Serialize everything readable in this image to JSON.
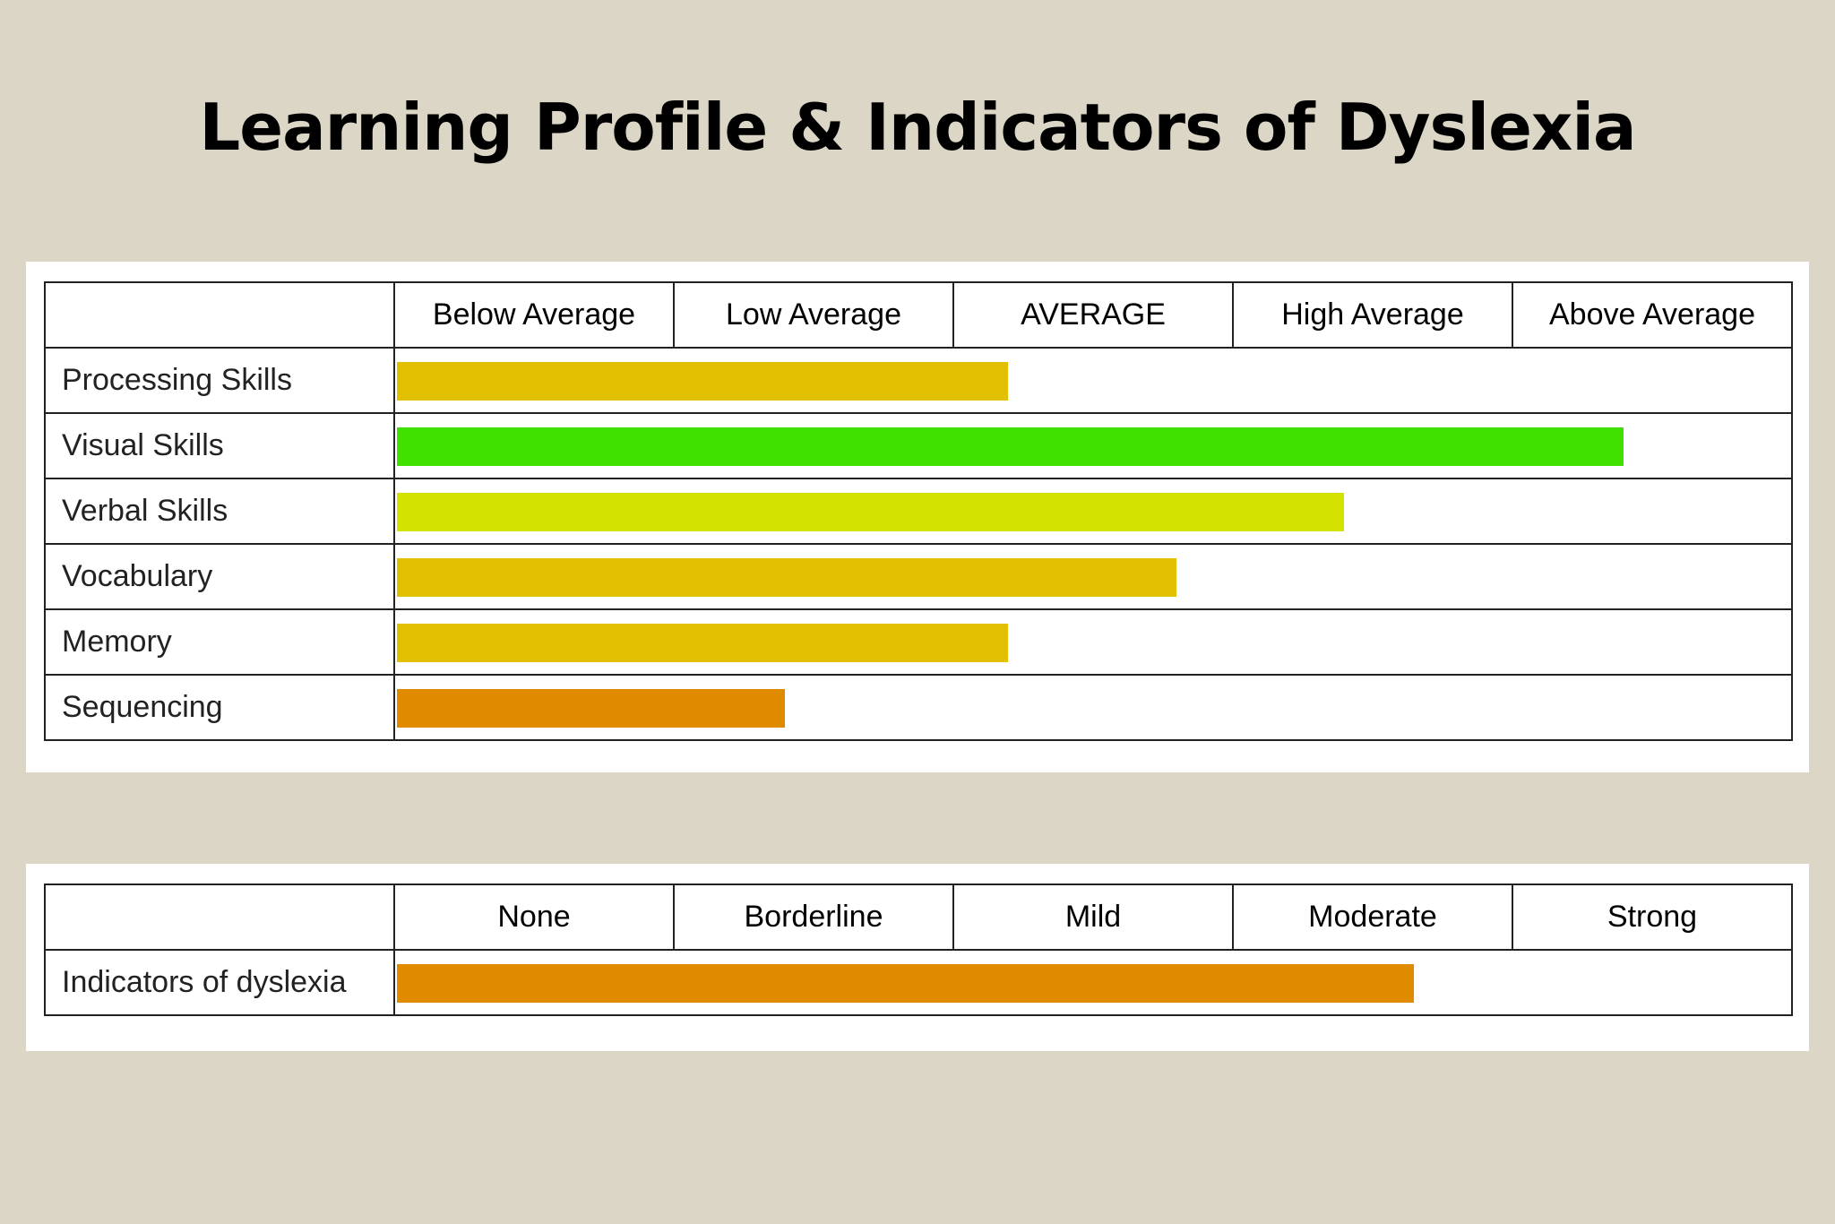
{
  "title": "Learning Profile & Indicators of Dyslexia",
  "chart_data": [
    {
      "type": "bar",
      "orientation": "horizontal",
      "scale_labels": [
        "Below Average",
        "Low Average",
        "AVERAGE",
        "High Average",
        "Above Average"
      ],
      "xlim": [
        0,
        5
      ],
      "categories": [
        "Processing Skills",
        "Visual Skills",
        "Verbal Skills",
        "Vocabulary",
        "Memory",
        "Sequencing"
      ],
      "values": [
        2.2,
        4.4,
        3.4,
        2.8,
        2.2,
        1.4
      ],
      "colors": [
        "#e0c000",
        "#40e000",
        "#d3e200",
        "#e0c000",
        "#e0c000",
        "#e08a00"
      ]
    },
    {
      "type": "bar",
      "orientation": "horizontal",
      "scale_labels": [
        "None",
        "Borderline",
        "Mild",
        "Moderate",
        "Strong"
      ],
      "xlim": [
        0,
        5
      ],
      "categories": [
        "Indicators of dyslexia"
      ],
      "values": [
        3.65
      ],
      "colors": [
        "#e08a00"
      ]
    }
  ]
}
